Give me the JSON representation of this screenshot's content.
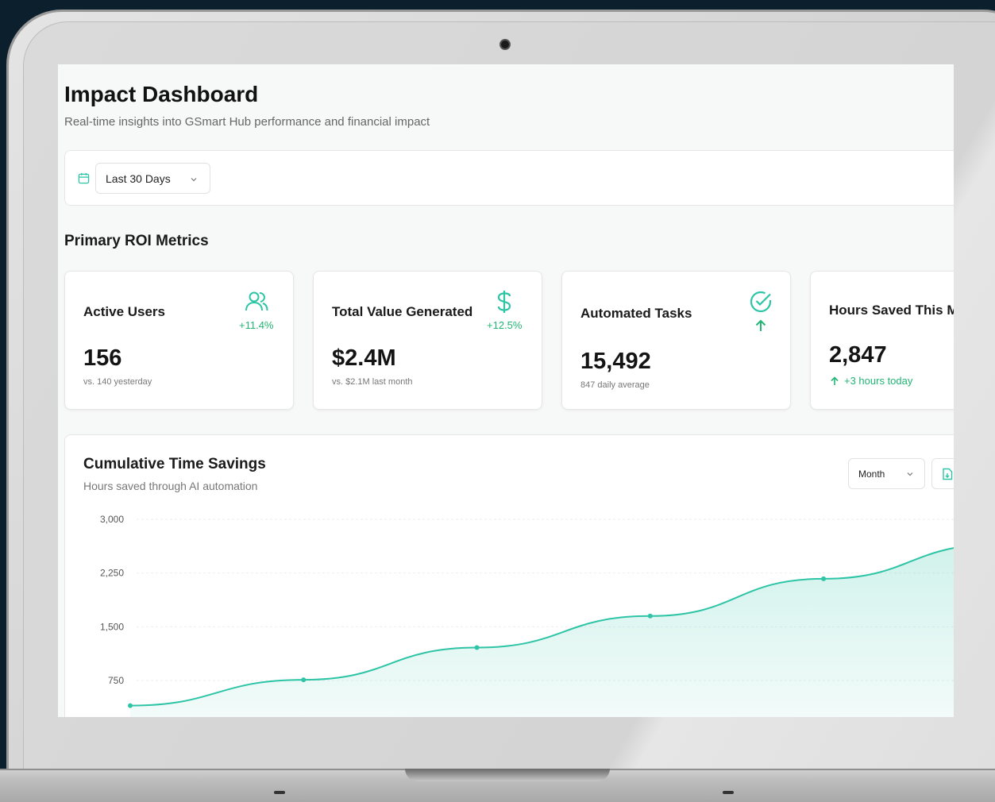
{
  "header": {
    "title": "Impact Dashboard",
    "subtitle": "Real-time insights into GSmart Hub performance and financial impact"
  },
  "filters": {
    "date_range": "Last 30 Days"
  },
  "primary_metrics": {
    "section_title": "Primary ROI Metrics",
    "cards": [
      {
        "label": "Active Users",
        "value": "156",
        "note": "vs. 140 yesterday",
        "change": "+11.4%",
        "icon": "users-icon"
      },
      {
        "label": "Total Value Generated",
        "value": "$2.4M",
        "note": "vs. $2.1M last month",
        "change": "+12.5%",
        "icon": "dollar-icon"
      },
      {
        "label": "Automated Tasks",
        "value": "15,492",
        "note": "847 daily average",
        "icon": "check-circle-icon",
        "trend_icon": "arrow-up-icon"
      },
      {
        "label": "Hours Saved This M",
        "value": "2,847",
        "note": "+3 hours today",
        "note_icon": "arrow-up-icon"
      }
    ]
  },
  "chart": {
    "title": "Cumulative Time Savings",
    "subtitle": "Hours saved through AI automation",
    "period": "Month",
    "export_icon": "file-export-icon",
    "accent": "#2ec4a6"
  },
  "chart_data": {
    "type": "area",
    "title": "Cumulative Time Savings",
    "subtitle": "Hours saved through AI automation",
    "x": [
      "",
      "",
      "",
      "",
      "",
      ""
    ],
    "series": [
      {
        "values": [
          400,
          760,
          1210,
          1650,
          2170,
          2650
        ]
      }
    ],
    "y_ticks": [
      "3,000",
      "2,250",
      "1,500",
      "750"
    ],
    "y_tick_values": [
      3000,
      2250,
      1500,
      750
    ],
    "ylim": [
      400,
      3000
    ],
    "grid": true,
    "colors": {
      "line": "#2ec4a6",
      "fill": "#2ec4a6",
      "positive": "#22b573"
    }
  }
}
